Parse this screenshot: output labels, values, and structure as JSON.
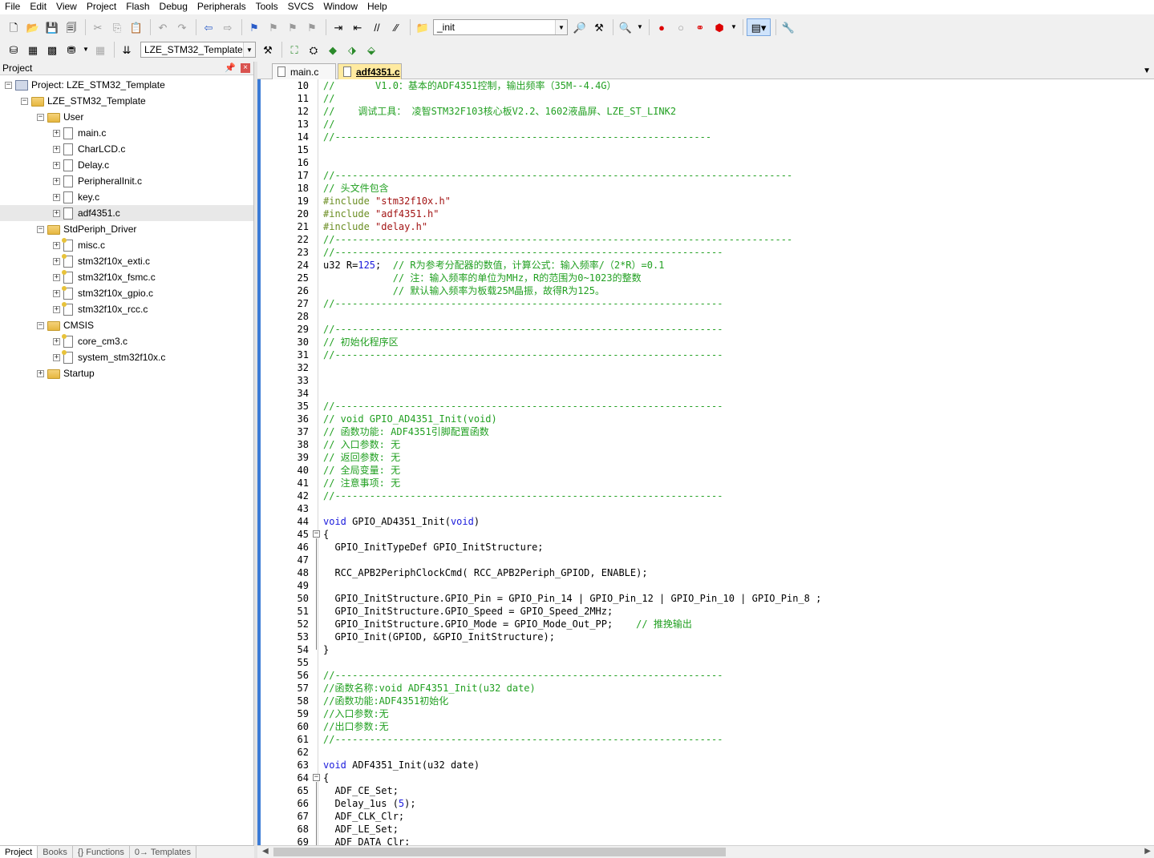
{
  "menu": [
    "File",
    "Edit",
    "View",
    "Project",
    "Flash",
    "Debug",
    "Peripherals",
    "Tools",
    "SVCS",
    "Window",
    "Help"
  ],
  "toolbar1": {
    "find_combo_value": "_init"
  },
  "toolbar2": {
    "target_combo_value": "LZE_STM32_Template"
  },
  "project_panel": {
    "title": "Project",
    "tree": [
      {
        "label": "Project: LZE_STM32_Template",
        "level": 0,
        "kind": "project",
        "expander": "⊟"
      },
      {
        "label": "LZE_STM32_Template",
        "level": 1,
        "kind": "folder",
        "expander": "⊟"
      },
      {
        "label": "User",
        "level": 2,
        "kind": "folder",
        "expander": "⊟"
      },
      {
        "label": "main.c",
        "level": 3,
        "kind": "file",
        "expander": "⊞"
      },
      {
        "label": "CharLCD.c",
        "level": 3,
        "kind": "file",
        "expander": "⊞"
      },
      {
        "label": "Delay.c",
        "level": 3,
        "kind": "file",
        "expander": "⊞"
      },
      {
        "label": "PeripheralInit.c",
        "level": 3,
        "kind": "file",
        "expander": "⊞"
      },
      {
        "label": "key.c",
        "level": 3,
        "kind": "file",
        "expander": "⊞"
      },
      {
        "label": "adf4351.c",
        "level": 3,
        "kind": "file",
        "expander": "⊞",
        "selected": true
      },
      {
        "label": "StdPeriph_Driver",
        "level": 2,
        "kind": "folder",
        "expander": "⊟"
      },
      {
        "label": "misc.c",
        "level": 3,
        "kind": "file-star",
        "expander": "⊞"
      },
      {
        "label": "stm32f10x_exti.c",
        "level": 3,
        "kind": "file-star",
        "expander": "⊞"
      },
      {
        "label": "stm32f10x_fsmc.c",
        "level": 3,
        "kind": "file-star",
        "expander": "⊞"
      },
      {
        "label": "stm32f10x_gpio.c",
        "level": 3,
        "kind": "file-star",
        "expander": "⊞"
      },
      {
        "label": "stm32f10x_rcc.c",
        "level": 3,
        "kind": "file-star",
        "expander": "⊞"
      },
      {
        "label": "CMSIS",
        "level": 2,
        "kind": "folder",
        "expander": "⊟"
      },
      {
        "label": "core_cm3.c",
        "level": 3,
        "kind": "file-star",
        "expander": "⊞"
      },
      {
        "label": "system_stm32f10x.c",
        "level": 3,
        "kind": "file-star",
        "expander": "⊞"
      },
      {
        "label": "Startup",
        "level": 2,
        "kind": "folder",
        "expander": "⊞"
      }
    ],
    "bottom_tabs": [
      "Project",
      "Books",
      "{} Functions",
      "0→ Templates"
    ]
  },
  "editor": {
    "tabs": [
      {
        "label": "main.c",
        "active": false
      },
      {
        "label": "adf4351.c",
        "active": true
      }
    ],
    "lines": [
      {
        "n": "10",
        "segs": [
          {
            "c": "cm",
            "t": "//       V1.0：基本的ADF4351控制，输出频率（35M--4.4G）"
          }
        ]
      },
      {
        "n": "11",
        "segs": [
          {
            "c": "cm",
            "t": "//"
          }
        ]
      },
      {
        "n": "12",
        "segs": [
          {
            "c": "cm",
            "t": "//    调试工具： 凌智STM32F103核心板V2.2、1602液晶屏、LZE_ST_LINK2"
          }
        ]
      },
      {
        "n": "13",
        "segs": [
          {
            "c": "cm",
            "t": "//"
          }
        ]
      },
      {
        "n": "14",
        "segs": [
          {
            "c": "cm",
            "t": "//-----------------------------------------------------------------"
          }
        ]
      },
      {
        "n": "15",
        "segs": []
      },
      {
        "n": "16",
        "segs": []
      },
      {
        "n": "17",
        "segs": [
          {
            "c": "cm",
            "t": "//-------------------------------------------------------------------------------"
          }
        ]
      },
      {
        "n": "18",
        "segs": [
          {
            "c": "cm",
            "t": "// 头文件包含"
          }
        ]
      },
      {
        "n": "19",
        "segs": [
          {
            "c": "pp",
            "t": "#include "
          },
          {
            "c": "str",
            "t": "\"stm32f10x.h\""
          }
        ]
      },
      {
        "n": "20",
        "segs": [
          {
            "c": "pp",
            "t": "#include "
          },
          {
            "c": "str",
            "t": "\"adf4351.h\""
          }
        ]
      },
      {
        "n": "21",
        "segs": [
          {
            "c": "pp",
            "t": "#include "
          },
          {
            "c": "str",
            "t": "\"delay.h\""
          }
        ]
      },
      {
        "n": "22",
        "segs": [
          {
            "c": "cm",
            "t": "//-------------------------------------------------------------------------------"
          }
        ]
      },
      {
        "n": "23",
        "segs": [
          {
            "c": "cm",
            "t": "//-------------------------------------------------------------------"
          }
        ]
      },
      {
        "n": "24",
        "segs": [
          {
            "c": "",
            "t": "u32 R="
          },
          {
            "c": "num",
            "t": "125"
          },
          {
            "c": "",
            "t": ";  "
          },
          {
            "c": "cm",
            "t": "// R为参考分配器的数值，计算公式：输入频率/（2*R）=0.1"
          }
        ]
      },
      {
        "n": "25",
        "segs": [
          {
            "c": "cm",
            "t": "            // 注：输入频率的单位为MHz，R的范围为0~1023的整数"
          }
        ]
      },
      {
        "n": "26",
        "segs": [
          {
            "c": "cm",
            "t": "            // 默认输入频率为板载25M晶振，故得R为125。"
          }
        ]
      },
      {
        "n": "27",
        "segs": [
          {
            "c": "cm",
            "t": "//-------------------------------------------------------------------"
          }
        ]
      },
      {
        "n": "28",
        "segs": []
      },
      {
        "n": "29",
        "segs": [
          {
            "c": "cm",
            "t": "//-------------------------------------------------------------------"
          }
        ]
      },
      {
        "n": "30",
        "segs": [
          {
            "c": "cm",
            "t": "// 初始化程序区"
          }
        ]
      },
      {
        "n": "31",
        "segs": [
          {
            "c": "cm",
            "t": "//-------------------------------------------------------------------"
          }
        ]
      },
      {
        "n": "32",
        "segs": []
      },
      {
        "n": "33",
        "segs": []
      },
      {
        "n": "34",
        "segs": []
      },
      {
        "n": "35",
        "segs": [
          {
            "c": "cm",
            "t": "//-------------------------------------------------------------------"
          }
        ]
      },
      {
        "n": "36",
        "segs": [
          {
            "c": "cm",
            "t": "// void GPIO_AD4351_Init(void)"
          }
        ]
      },
      {
        "n": "37",
        "segs": [
          {
            "c": "cm",
            "t": "// 函数功能: ADF4351引脚配置函数"
          }
        ]
      },
      {
        "n": "38",
        "segs": [
          {
            "c": "cm",
            "t": "// 入口参数: 无"
          }
        ]
      },
      {
        "n": "39",
        "segs": [
          {
            "c": "cm",
            "t": "// 返回参数: 无"
          }
        ]
      },
      {
        "n": "40",
        "segs": [
          {
            "c": "cm",
            "t": "// 全局变量: 无"
          }
        ]
      },
      {
        "n": "41",
        "segs": [
          {
            "c": "cm",
            "t": "// 注意事项: 无"
          }
        ]
      },
      {
        "n": "42",
        "segs": [
          {
            "c": "cm",
            "t": "//-------------------------------------------------------------------"
          }
        ]
      },
      {
        "n": "43",
        "segs": []
      },
      {
        "n": "44",
        "segs": [
          {
            "c": "kw",
            "t": "void"
          },
          {
            "c": "",
            "t": " GPIO_AD4351_Init("
          },
          {
            "c": "kw",
            "t": "void"
          },
          {
            "c": "",
            "t": ")"
          }
        ]
      },
      {
        "n": "45",
        "fold": "open",
        "segs": [
          {
            "c": "",
            "t": "{"
          }
        ]
      },
      {
        "n": "46",
        "segs": [
          {
            "c": "",
            "t": "  GPIO_InitTypeDef GPIO_InitStructure;"
          }
        ]
      },
      {
        "n": "47",
        "segs": []
      },
      {
        "n": "48",
        "segs": [
          {
            "c": "",
            "t": "  RCC_APB2PeriphClockCmd( RCC_APB2Periph_GPIOD, ENABLE);"
          }
        ]
      },
      {
        "n": "49",
        "segs": []
      },
      {
        "n": "50",
        "segs": [
          {
            "c": "",
            "t": "  GPIO_InitStructure.GPIO_Pin = GPIO_Pin_14 | GPIO_Pin_12 | GPIO_Pin_10 | GPIO_Pin_8 ;"
          }
        ]
      },
      {
        "n": "51",
        "segs": [
          {
            "c": "",
            "t": "  GPIO_InitStructure.GPIO_Speed = GPIO_Speed_2MHz;"
          }
        ]
      },
      {
        "n": "52",
        "segs": [
          {
            "c": "",
            "t": "  GPIO_InitStructure.GPIO_Mode = GPIO_Mode_Out_PP;    "
          },
          {
            "c": "cm",
            "t": "// 推挽输出"
          }
        ]
      },
      {
        "n": "53",
        "segs": [
          {
            "c": "",
            "t": "  GPIO_Init(GPIOD, &GPIO_InitStructure);"
          }
        ]
      },
      {
        "n": "54",
        "fold": "end",
        "segs": [
          {
            "c": "",
            "t": "}"
          }
        ]
      },
      {
        "n": "55",
        "segs": []
      },
      {
        "n": "56",
        "segs": [
          {
            "c": "cm",
            "t": "//-------------------------------------------------------------------"
          }
        ]
      },
      {
        "n": "57",
        "segs": [
          {
            "c": "cm",
            "t": "//函数名称:void ADF4351_Init(u32 date)"
          }
        ]
      },
      {
        "n": "58",
        "segs": [
          {
            "c": "cm",
            "t": "//函数功能:ADF4351初始化"
          }
        ]
      },
      {
        "n": "59",
        "segs": [
          {
            "c": "cm",
            "t": "//入口参数:无"
          }
        ]
      },
      {
        "n": "60",
        "segs": [
          {
            "c": "cm",
            "t": "//出口参数:无"
          }
        ]
      },
      {
        "n": "61",
        "segs": [
          {
            "c": "cm",
            "t": "//-------------------------------------------------------------------"
          }
        ]
      },
      {
        "n": "62",
        "segs": []
      },
      {
        "n": "63",
        "segs": [
          {
            "c": "kw",
            "t": "void"
          },
          {
            "c": "",
            "t": " ADF4351_Init(u32 date)"
          }
        ]
      },
      {
        "n": "64",
        "fold": "open",
        "segs": [
          {
            "c": "",
            "t": "{"
          }
        ]
      },
      {
        "n": "65",
        "segs": [
          {
            "c": "",
            "t": "  ADF_CE_Set;"
          }
        ]
      },
      {
        "n": "66",
        "segs": [
          {
            "c": "",
            "t": "  Delay_1us ("
          },
          {
            "c": "num",
            "t": "5"
          },
          {
            "c": "",
            "t": ");"
          }
        ]
      },
      {
        "n": "67",
        "segs": [
          {
            "c": "",
            "t": "  ADF_CLK_Clr;"
          }
        ]
      },
      {
        "n": "68",
        "segs": [
          {
            "c": "",
            "t": "  ADF_LE_Set;"
          }
        ]
      },
      {
        "n": "69",
        "segs": [
          {
            "c": "",
            "t": "  ADF_DATA_Clr;"
          }
        ]
      }
    ]
  }
}
